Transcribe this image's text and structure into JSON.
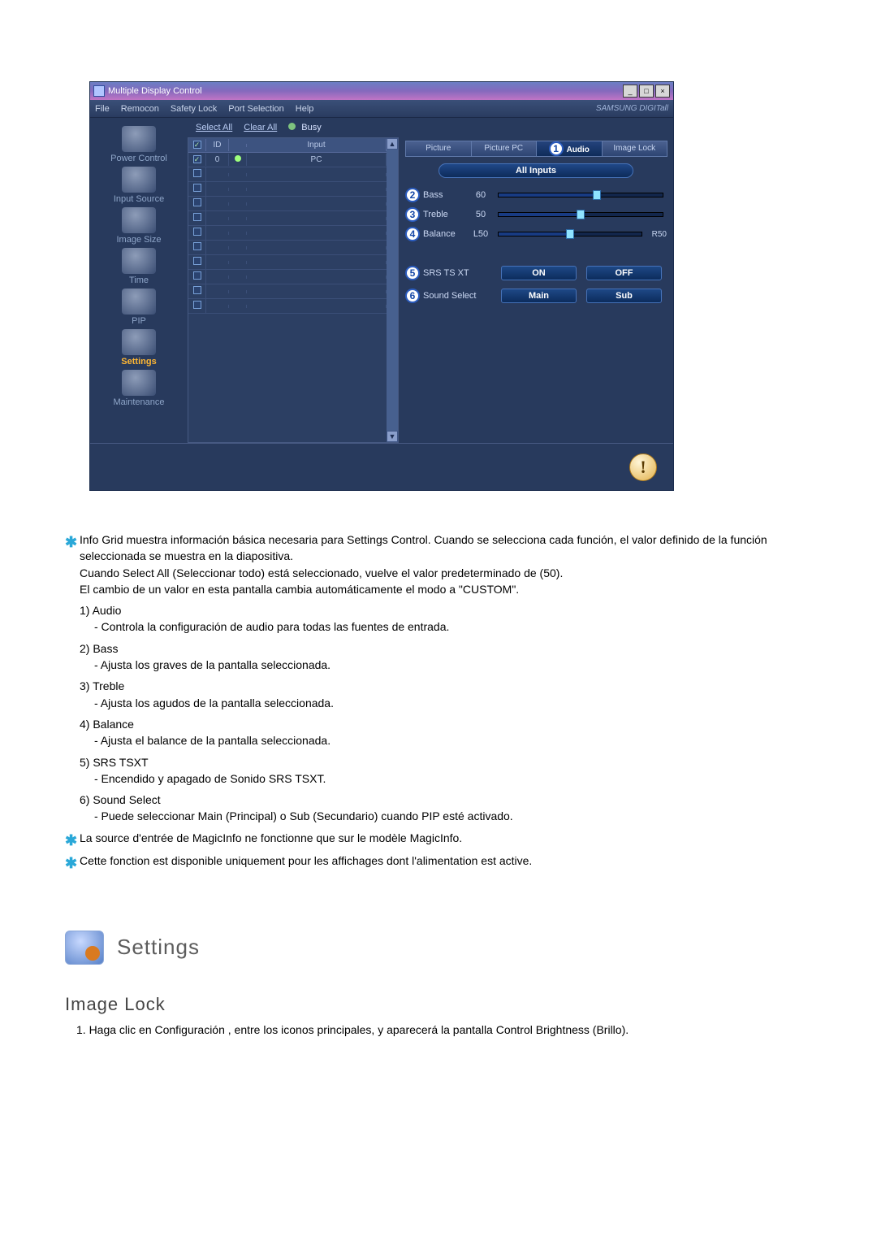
{
  "window": {
    "title": "Multiple Display Control",
    "win_min": "_",
    "win_max": "□",
    "win_close": "×"
  },
  "menubar": {
    "items": [
      "File",
      "Remocon",
      "Safety Lock",
      "Port Selection",
      "Help"
    ],
    "brand": "SAMSUNG DIGITall"
  },
  "sidebar": {
    "items": [
      {
        "label": "Power Control"
      },
      {
        "label": "Input Source"
      },
      {
        "label": "Image Size"
      },
      {
        "label": "Time"
      },
      {
        "label": "PIP"
      },
      {
        "label": "Settings",
        "selected": true
      },
      {
        "label": "Maintenance"
      }
    ]
  },
  "toolbar": {
    "select_all": "Select All",
    "clear_all": "Clear All",
    "busy": "Busy"
  },
  "grid": {
    "headers": {
      "chk": "",
      "id": "ID",
      "status": "",
      "input": "Input"
    },
    "rows": [
      {
        "checked": true,
        "id": "0",
        "status": true,
        "input": "PC"
      },
      {
        "checked": false,
        "id": "",
        "status": false,
        "input": ""
      },
      {
        "checked": false,
        "id": "",
        "status": false,
        "input": ""
      },
      {
        "checked": false,
        "id": "",
        "status": false,
        "input": ""
      },
      {
        "checked": false,
        "id": "",
        "status": false,
        "input": ""
      },
      {
        "checked": false,
        "id": "",
        "status": false,
        "input": ""
      },
      {
        "checked": false,
        "id": "",
        "status": false,
        "input": ""
      },
      {
        "checked": false,
        "id": "",
        "status": false,
        "input": ""
      },
      {
        "checked": false,
        "id": "",
        "status": false,
        "input": ""
      },
      {
        "checked": false,
        "id": "",
        "status": false,
        "input": ""
      },
      {
        "checked": false,
        "id": "",
        "status": false,
        "input": ""
      }
    ]
  },
  "tabs": {
    "items": [
      {
        "label": "Picture"
      },
      {
        "label": "Picture PC"
      },
      {
        "label": "Audio",
        "selected": true,
        "callout": "1"
      },
      {
        "label": "Image Lock"
      }
    ]
  },
  "panel": {
    "all_inputs": "All Inputs",
    "bass": {
      "callout": "2",
      "label": "Bass",
      "value": "60",
      "percent": 60,
      "l": "",
      "r": ""
    },
    "treble": {
      "callout": "3",
      "label": "Treble",
      "value": "50",
      "percent": 50,
      "l": "",
      "r": ""
    },
    "balance": {
      "callout": "4",
      "label": "Balance",
      "value": "L50",
      "percent": 50,
      "l": "",
      "r": "R50"
    },
    "srs": {
      "callout": "5",
      "label": "SRS TS XT",
      "opt1": "ON",
      "opt2": "OFF"
    },
    "sound": {
      "callout": "6",
      "label": "Sound Select",
      "opt1": "Main",
      "opt2": "Sub"
    }
  },
  "notes": {
    "intro": [
      "Info Grid muestra información básica necesaria para Settings Control. Cuando se selecciona cada función, el valor definido de la función seleccionada se muestra en la diapositiva.",
      "Cuando Select All (Seleccionar todo) está seleccionado, vuelve el valor predeterminado de (50).",
      "El cambio de un valor en esta pantalla cambia automáticamente el modo a \"CUSTOM\"."
    ],
    "items": [
      {
        "n": "1)",
        "head": "Audio",
        "desc": "- Controla la configuración de audio para todas las fuentes de entrada."
      },
      {
        "n": "2)",
        "head": "Bass",
        "desc": "- Ajusta los graves de la pantalla seleccionada."
      },
      {
        "n": "3)",
        "head": "Treble",
        "desc": "- Ajusta los agudos de la pantalla seleccionada."
      },
      {
        "n": "4)",
        "head": "Balance",
        "desc": "- Ajusta el balance de la pantalla seleccionada."
      },
      {
        "n": "5)",
        "head": "SRS TSXT",
        "desc": "- Encendido y apagado de Sonido SRS TSXT."
      },
      {
        "n": "6)",
        "head": "Sound Select",
        "desc": "- Puede seleccionar Main (Principal) o Sub (Secundario) cuando PIP esté activado."
      }
    ],
    "foot": [
      "La source d'entrée de MagicInfo ne fonctionne que sur le modèle MagicInfo.",
      "Cette fonction est disponible uniquement pour les affichages dont l'alimentation est active."
    ]
  },
  "section": {
    "title": "Settings",
    "subheader": "Image Lock",
    "step1": "1.  Haga clic en Configuración , entre los iconos principales, y aparecerá la pantalla Control Brightness (Brillo)."
  }
}
